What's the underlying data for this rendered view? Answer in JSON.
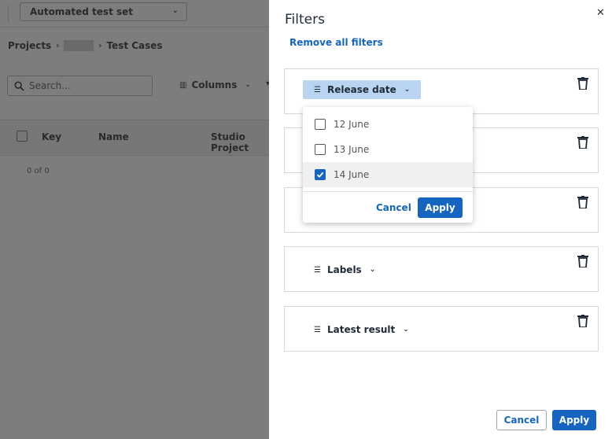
{
  "background": {
    "test_set_select": "Automated test set",
    "breadcrumb": {
      "projects": "Projects",
      "current": "Test Cases"
    },
    "search_placeholder": "Search...",
    "columns_label": "Columns",
    "table_headers": {
      "key": "Key",
      "name": "Name",
      "studio_project": "Studio Project"
    },
    "count": "0 of 0"
  },
  "panel": {
    "title": "Filters",
    "remove_all": "Remove all filters",
    "filters": [
      {
        "label": "Release date",
        "active": true
      },
      {
        "label": "",
        "active": false
      },
      {
        "label": "",
        "active": false
      },
      {
        "label": "Labels",
        "active": false
      },
      {
        "label": "Latest result",
        "active": false
      }
    ],
    "dropdown": {
      "options": [
        {
          "label": "12 June",
          "checked": false
        },
        {
          "label": "13 June",
          "checked": false
        },
        {
          "label": "14 June",
          "checked": true
        }
      ],
      "cancel": "Cancel",
      "apply": "Apply"
    },
    "footer": {
      "cancel": "Cancel",
      "apply": "Apply"
    }
  },
  "colors": {
    "accent": "#1565c0",
    "chip_active": "#b9d4f1",
    "overlay": "#7d7d7d"
  },
  "icons": [
    "chevron-down-icon",
    "search-icon",
    "columns-icon",
    "close-icon",
    "filter-icon",
    "trash-icon",
    "checkbox-icon"
  ]
}
